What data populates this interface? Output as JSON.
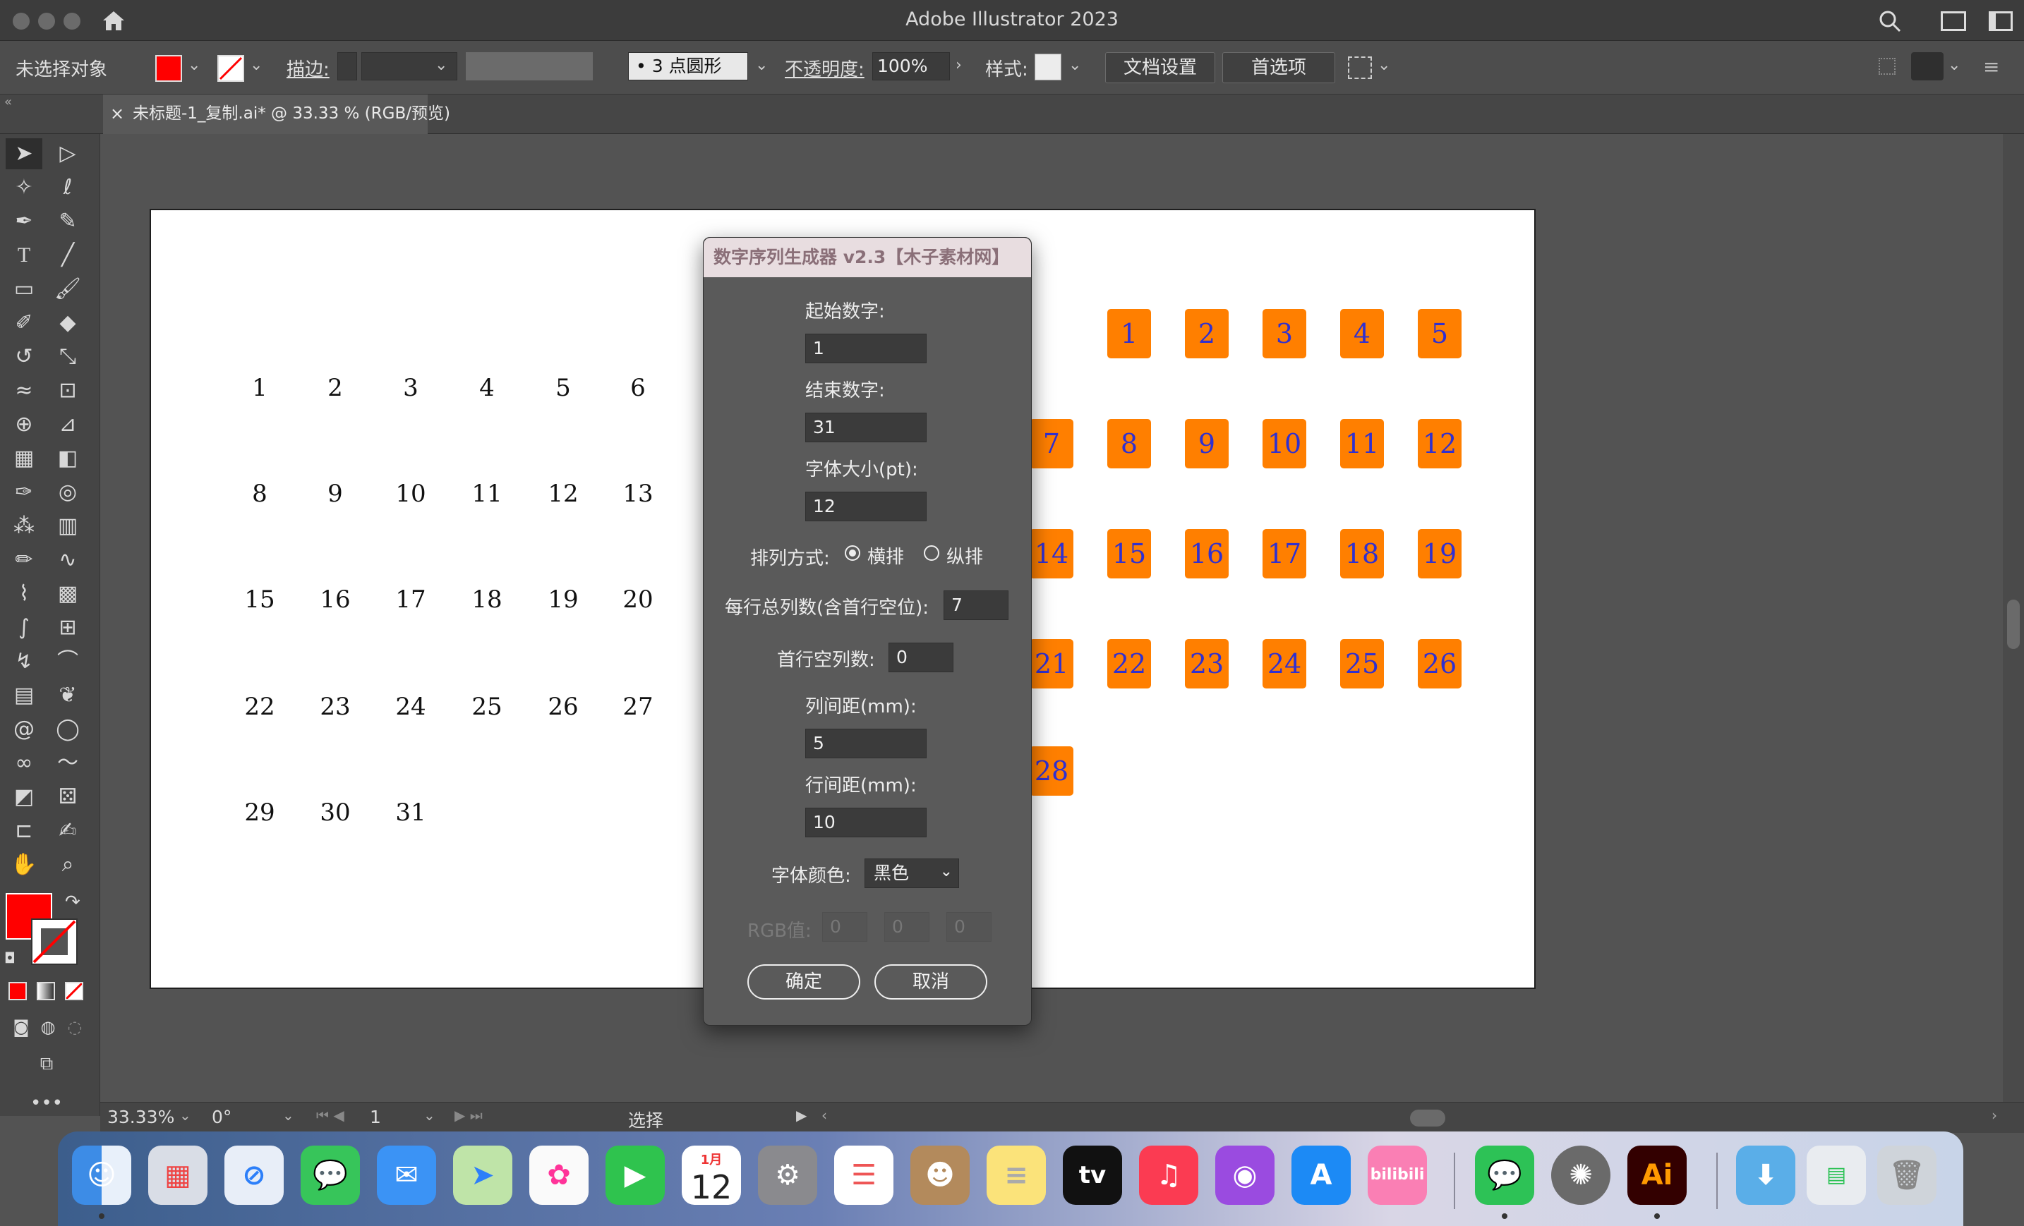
{
  "window": {
    "title": "Adobe Illustrator 2023"
  },
  "control_bar": {
    "selection_status": "未选择对象",
    "stroke_label": "描边:",
    "brush_label": "3 点圆形",
    "opacity_label": "不透明度:",
    "opacity_value": "100%",
    "style_label": "样式:",
    "doc_setup_button": "文档设置",
    "preferences_button": "首选项",
    "fill_color": "#ff0000"
  },
  "document_tab": {
    "title": "未标题-1_复制.ai* @ 33.33 % (RGB/预览)",
    "close": "×"
  },
  "artboard": {
    "plain_numbers": [
      [
        "1",
        "2",
        "3",
        "4",
        "5",
        "6"
      ],
      [
        "8",
        "9",
        "10",
        "11",
        "12",
        "13"
      ],
      [
        "15",
        "16",
        "17",
        "18",
        "19",
        "20"
      ],
      [
        "22",
        "23",
        "24",
        "25",
        "26",
        "27"
      ],
      [
        "29",
        "30",
        "31"
      ]
    ],
    "boxed_numbers": [
      [
        "1",
        "2",
        "3",
        "4",
        "5"
      ],
      [
        "7",
        "8",
        "9",
        "10",
        "11",
        "12"
      ],
      [
        "14",
        "15",
        "16",
        "17",
        "18",
        "19"
      ],
      [
        "21",
        "22",
        "23",
        "24",
        "25",
        "26"
      ],
      [
        "28"
      ]
    ],
    "box_color": "#ff7f00",
    "box_text_color": "#3030d0"
  },
  "dialog": {
    "title": "数字序列生成器 v2.3【木子素材网】",
    "start_label": "起始数字:",
    "start_value": "1",
    "end_label": "结束数字:",
    "end_value": "31",
    "fontsize_label": "字体大小(pt):",
    "fontsize_value": "12",
    "arrange_label": "排列方式:",
    "arrange_horizontal": "横排",
    "arrange_vertical": "纵排",
    "columns_label": "每行总列数(含首行空位):",
    "columns_value": "7",
    "first_empty_label": "首行空列数:",
    "first_empty_value": "0",
    "col_gap_label": "列间距(mm):",
    "col_gap_value": "5",
    "row_gap_label": "行间距(mm):",
    "row_gap_value": "10",
    "color_label": "字体颜色:",
    "color_value": "黑色",
    "rgb_label": "RGB值:",
    "rgb_r": "0",
    "rgb_g": "0",
    "rgb_b": "0",
    "ok_button": "确定",
    "cancel_button": "取消"
  },
  "status_bar": {
    "zoom": "33.33%",
    "rotation": "0°",
    "artboard_index": "1",
    "tool_status": "选择"
  },
  "dock": {
    "calendar_month": "1月",
    "calendar_day": "12",
    "apple_tv": "tv",
    "illustrator": "Ai",
    "bilibili": "bilibili"
  }
}
